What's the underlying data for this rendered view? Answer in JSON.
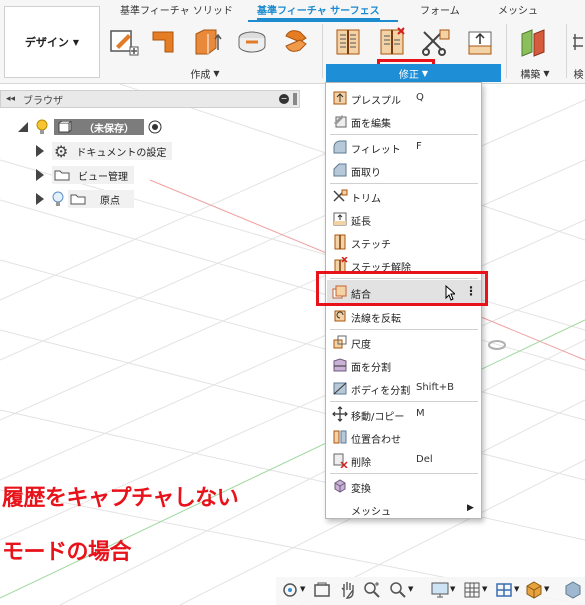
{
  "ribbon": {
    "design_label": "デザイン",
    "tabs": [
      "基準フィーチャ ソリッド",
      "基準フィーチャ サーフェス",
      "フォーム",
      "メッシュ"
    ],
    "active_tab_index": 1,
    "group_create": "作成",
    "group_modify": "修正",
    "group_construct": "構築",
    "group_inspect_partial": "検"
  },
  "browser": {
    "title": "ブラウザ",
    "root_label": "（未保存）",
    "items": [
      "ドキュメントの設定",
      "ビュー管理",
      "原点"
    ]
  },
  "menu": {
    "items": [
      {
        "label": "プレスプル",
        "key": "Q"
      },
      {
        "label": "面を編集",
        "key": ""
      },
      {
        "label": "フィレット",
        "key": "F"
      },
      {
        "label": "面取り",
        "key": ""
      },
      {
        "label": "トリム",
        "key": ""
      },
      {
        "label": "延長",
        "key": ""
      },
      {
        "label": "ステッチ",
        "key": ""
      },
      {
        "label": "ステッチ解除",
        "key": ""
      },
      {
        "label": "結合",
        "key": ""
      },
      {
        "label": "法線を反転",
        "key": ""
      },
      {
        "label": "尺度",
        "key": ""
      },
      {
        "label": "面を分割",
        "key": ""
      },
      {
        "label": "ボディを分割",
        "key": "Shift+B"
      },
      {
        "label": "移動/コピー",
        "key": "M"
      },
      {
        "label": "位置合わせ",
        "key": ""
      },
      {
        "label": "削除",
        "key": "Del"
      },
      {
        "label": "変換",
        "key": ""
      },
      {
        "label": "メッシュ",
        "key": ""
      }
    ]
  },
  "annotation": {
    "line1": "履歴をキャプチャしない",
    "line2": "モードの場合"
  },
  "colors": {
    "accent_blue": "#1e8fd6",
    "highlight_red": "#e8121a",
    "menu_highlight": "#e2e2e2"
  }
}
